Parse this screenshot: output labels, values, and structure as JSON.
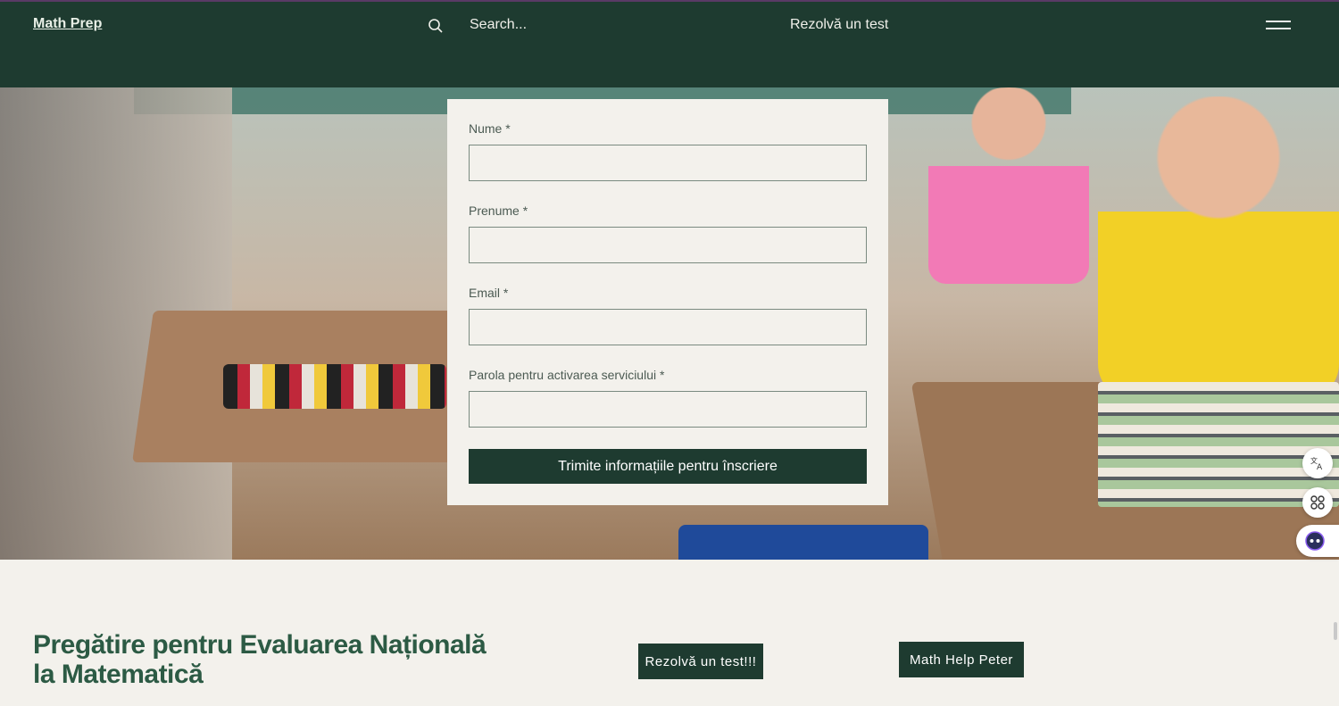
{
  "header": {
    "logo": "Math Prep",
    "search_placeholder": "Search...",
    "nav_link": "Rezolvă un test",
    "menu_icon": "hamburger-icon",
    "background_color": "#1e3b30"
  },
  "form": {
    "fields": [
      {
        "label": "Nume *",
        "value": ""
      },
      {
        "label": "Prenume *",
        "value": ""
      },
      {
        "label": "Email *",
        "value": ""
      },
      {
        "label": "Parola pentru activarea serviciului *",
        "value": ""
      }
    ],
    "submit_label": "Trimite informațiile pentru înscriere"
  },
  "widgets": {
    "translate_icon": "translate-icon",
    "apps_icon": "apps-icon",
    "assistant_icon": "assistant-icon"
  },
  "bottom": {
    "headline_line1": "Pregătire pentru Evaluarea Națională",
    "headline_line2": "la Matematică",
    "cta_test": "Rezolvă un test!!!",
    "cta_help": "Math Help Peter"
  },
  "colors": {
    "accent": "#1e3b30",
    "headline": "#2c5a44",
    "page_background": "#f3f1ec"
  }
}
